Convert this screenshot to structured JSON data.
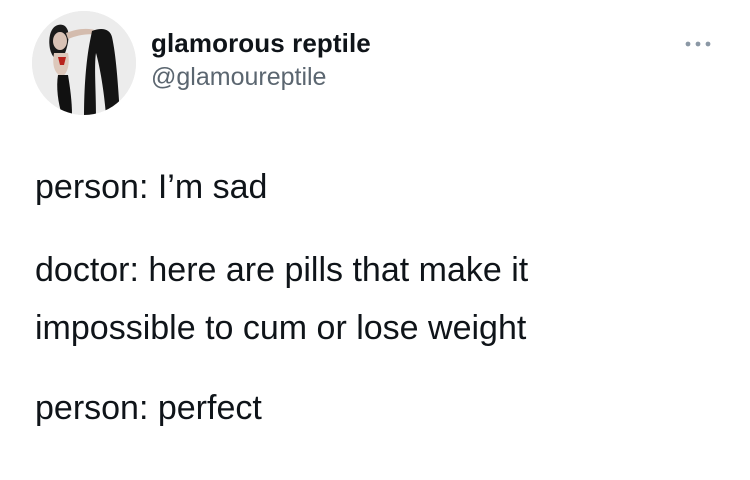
{
  "tweet": {
    "display_name": "glamorous reptile",
    "handle": "@glamoureptile",
    "more_icon": "more-horizontal-icon",
    "lines": [
      "person: I’m sad",
      "doctor: here are pills that make it",
      "impossible to cum or lose weight",
      "person: perfect"
    ]
  }
}
